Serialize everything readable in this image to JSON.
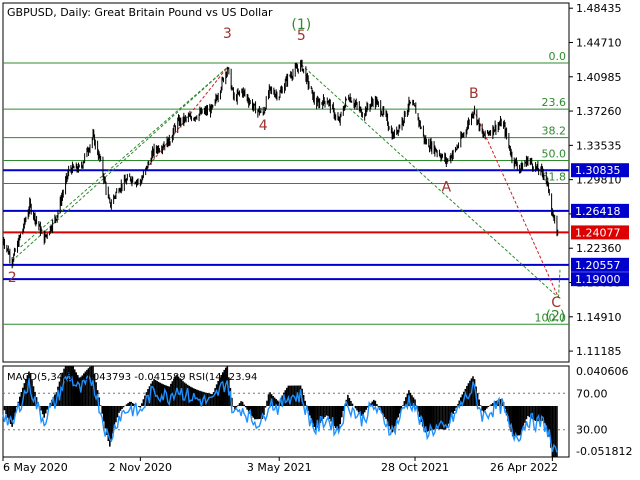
{
  "title": "GBPUSD, Daily:  Great Britain Pound vs US Dollar",
  "colors": {
    "background": "#ffffff",
    "frame": "#000000",
    "candle": "#000000",
    "fib_line": "#2e8b2e",
    "fib_label": "#2e8b2e",
    "level_blue": "#0000cc",
    "level_red": "#dd0000",
    "wave_red": "#a0322d",
    "wave_green": "#2e8b2e",
    "trend_green": "#2e8b2e",
    "trend_red": "#cc2020",
    "macd_hist": "#000000",
    "macd_signal": "#cc0000",
    "rsi_line": "#1e90ff",
    "rsi_levels": "#777777"
  },
  "chart_data": [
    {
      "type": "candlestick",
      "name": "GBPUSD Daily",
      "price_axis": {
        "labels": [
          "1.48435",
          "1.44710",
          "1.40985",
          "1.37260",
          "1.33535",
          "1.29810",
          "1.26085",
          "1.22360",
          "1.18635",
          "1.14910",
          "1.11185"
        ],
        "values": [
          1.48435,
          1.4471,
          1.40985,
          1.3726,
          1.33535,
          1.2981,
          1.26085,
          1.2236,
          1.18635,
          1.1491,
          1.11185
        ],
        "range": [
          1.1,
          1.49
        ]
      },
      "time_axis": {
        "labels": [
          "6 May 2020",
          "2 Nov 2020",
          "3 May 2021",
          "28 Oct 2021",
          "26 Apr 2022"
        ],
        "dates": [
          "2020-05-06",
          "2020-11-02",
          "2021-05-03",
          "2021-10-28",
          "2022-04-26"
        ],
        "range": [
          "2020-05-06",
          "2022-05-06"
        ]
      },
      "close_series": [
        [
          "2020-05-06",
          1.2335
        ],
        [
          "2020-05-18",
          1.21
        ],
        [
          "2020-06-01",
          1.245
        ],
        [
          "2020-06-10",
          1.27
        ],
        [
          "2020-06-29",
          1.234
        ],
        [
          "2020-07-15",
          1.258
        ],
        [
          "2020-08-01",
          1.31
        ],
        [
          "2020-08-15",
          1.31
        ],
        [
          "2020-09-01",
          1.345
        ],
        [
          "2020-09-10",
          1.32
        ],
        [
          "2020-09-23",
          1.27
        ],
        [
          "2020-10-05",
          1.29
        ],
        [
          "2020-10-20",
          1.3
        ],
        [
          "2020-11-02",
          1.295
        ],
        [
          "2020-11-20",
          1.33
        ],
        [
          "2020-12-10",
          1.34
        ],
        [
          "2020-12-20",
          1.36
        ],
        [
          "2021-01-05",
          1.365
        ],
        [
          "2021-01-20",
          1.37
        ],
        [
          "2021-02-05",
          1.375
        ],
        [
          "2021-02-24",
          1.42
        ],
        [
          "2021-03-05",
          1.385
        ],
        [
          "2021-03-15",
          1.395
        ],
        [
          "2021-04-01",
          1.375
        ],
        [
          "2021-04-12",
          1.37
        ],
        [
          "2021-04-20",
          1.395
        ],
        [
          "2021-05-03",
          1.39
        ],
        [
          "2021-05-15",
          1.41
        ],
        [
          "2021-06-01",
          1.423
        ],
        [
          "2021-06-20",
          1.38
        ],
        [
          "2021-07-05",
          1.385
        ],
        [
          "2021-07-20",
          1.36
        ],
        [
          "2021-08-01",
          1.39
        ],
        [
          "2021-08-20",
          1.37
        ],
        [
          "2021-09-05",
          1.385
        ],
        [
          "2021-09-20",
          1.365
        ],
        [
          "2021-09-29",
          1.345
        ],
        [
          "2021-10-10",
          1.36
        ],
        [
          "2021-10-20",
          1.38
        ],
        [
          "2021-10-28",
          1.375
        ],
        [
          "2021-11-10",
          1.34
        ],
        [
          "2021-11-25",
          1.33
        ],
        [
          "2021-12-08",
          1.318
        ],
        [
          "2021-12-20",
          1.33
        ],
        [
          "2022-01-01",
          1.35
        ],
        [
          "2022-01-13",
          1.374
        ],
        [
          "2022-01-25",
          1.345
        ],
        [
          "2022-02-10",
          1.355
        ],
        [
          "2022-02-20",
          1.36
        ],
        [
          "2022-03-05",
          1.32
        ],
        [
          "2022-03-15",
          1.31
        ],
        [
          "2022-03-25",
          1.32
        ],
        [
          "2022-04-05",
          1.31
        ],
        [
          "2022-04-15",
          1.305
        ],
        [
          "2022-04-22",
          1.285
        ],
        [
          "2022-04-26",
          1.26
        ],
        [
          "2022-04-29",
          1.25
        ],
        [
          "2022-05-03",
          1.24
        ]
      ],
      "fibonacci": {
        "levels": [
          {
            "label": "0.0",
            "value": 1.4248
          },
          {
            "label": "23.6",
            "value": 1.3747
          },
          {
            "label": "38.2",
            "value": 1.3438
          },
          {
            "label": "50.0",
            "value": 1.3189
          },
          {
            "label": "61.8",
            "value": 1.2939
          },
          {
            "label": "100.0",
            "value": 1.141
          }
        ]
      },
      "levels": [
        {
          "label": "1.30835",
          "value": 1.30835,
          "color": "#0000cc"
        },
        {
          "label": "1.26418",
          "value": 1.26418,
          "color": "#0000cc"
        },
        {
          "label": "1.24077",
          "value": 1.24077,
          "color": "#dd0000"
        },
        {
          "label": "1.20557",
          "value": 1.20557,
          "color": "#0000cc"
        },
        {
          "label": "1.19000",
          "value": 1.19,
          "color": "#0000cc"
        }
      ],
      "wave_labels": [
        {
          "text": "2",
          "date": "2020-05-18",
          "price": 1.187,
          "color": "#a0322d"
        },
        {
          "text": "3",
          "date": "2021-02-24",
          "price": 1.452,
          "color": "#a0322d"
        },
        {
          "text": "4",
          "date": "2021-04-12",
          "price": 1.352,
          "color": "#a0322d"
        },
        {
          "text": "5",
          "date": "2021-06-01",
          "price": 1.45,
          "color": "#a0322d"
        },
        {
          "text": "(1)",
          "date": "2021-06-01",
          "price": 1.462,
          "color": "#2e8b2e"
        },
        {
          "text": "A",
          "date": "2021-12-08",
          "price": 1.285,
          "color": "#a0322d"
        },
        {
          "text": "B",
          "date": "2022-01-13",
          "price": 1.387,
          "color": "#a0322d"
        },
        {
          "text": "C",
          "date": "2022-05-01",
          "price": 1.16,
          "color": "#a0322d"
        },
        {
          "text": "(2)",
          "date": "2022-04-30",
          "price": 1.145,
          "color": "#2e8b2e"
        }
      ],
      "trend_lines": [
        {
          "points": [
            [
              "2020-05-18",
              1.21
            ],
            [
              "2021-02-24",
              1.42
            ]
          ],
          "color": "#2e8b2e"
        },
        {
          "points": [
            [
              "2020-05-29",
              1.225
            ],
            [
              "2021-02-24",
              1.42
            ]
          ],
          "color": "#2e8b2e"
        },
        {
          "points": [
            [
              "2020-11-10",
              1.31
            ],
            [
              "2021-02-24",
              1.42
            ]
          ],
          "color": "#cc2020"
        },
        {
          "points": [
            [
              "2021-06-01",
              1.423
            ],
            [
              "2022-05-04",
              1.17
            ]
          ],
          "color": "#2e8b2e"
        },
        {
          "points": [
            [
              "2022-01-13",
              1.374
            ],
            [
              "2022-05-04",
              1.17
            ]
          ],
          "color": "#cc2020"
        },
        {
          "points": [
            [
              "2022-05-04",
              1.17
            ],
            [
              "2022-05-06",
              1.2
            ]
          ],
          "color": "#2e8b2e"
        }
      ]
    },
    {
      "type": "indicator",
      "label": "MACD(5,34,5) -0.043793 -0.041589 RSI(14) 23.94",
      "macd": {
        "params": [
          5,
          34,
          5
        ],
        "value": -0.043793,
        "signal": -0.041589,
        "axis": {
          "labels": [
            "0.040606",
            "-0.051812"
          ],
          "values": [
            0.040606,
            -0.051812
          ]
        }
      },
      "rsi": {
        "period": 14,
        "value": 23.94,
        "levels": {
          "labels": [
            "70.00",
            "30.00"
          ],
          "values": [
            70,
            30
          ]
        }
      }
    }
  ]
}
